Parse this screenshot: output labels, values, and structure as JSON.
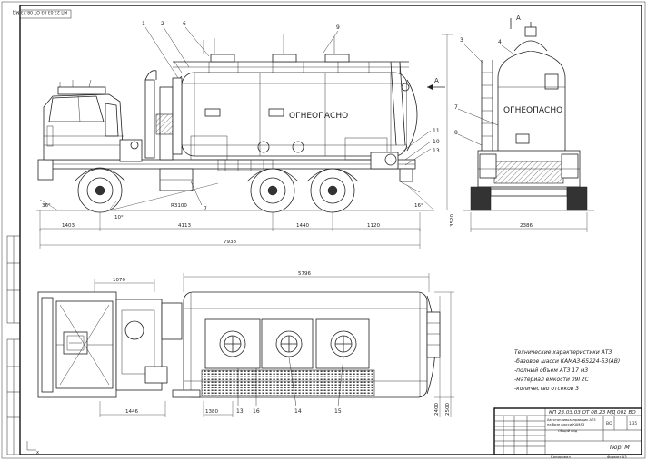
{
  "stamp_top_left": "КП 23.03.03 ОТ 08.23 МД",
  "side_view": {
    "tank_label": "ОГНЕОПАСНО",
    "position_numbers": [
      "1",
      "2",
      "6",
      "9",
      "11",
      "10",
      "13",
      "7"
    ],
    "section_mark": "А",
    "angle_left": "36°",
    "angle_middle": "10°",
    "angle_right": "16°",
    "radius": "R3100",
    "dim_front": "1403",
    "dim_base1": "4113",
    "dim_base2": "1440",
    "dim_rear": "1120",
    "dim_total_length": "7938",
    "dim_height": "3520"
  },
  "rear_view": {
    "tank_label": "ОГНЕОПАСНО",
    "position_numbers": [
      "3",
      "4",
      "7",
      "8"
    ],
    "section_mark": "А",
    "dim_width": "2386"
  },
  "top_view": {
    "position_numbers": [
      "13",
      "16",
      "14",
      "15"
    ],
    "dim_cab": "1070",
    "dim_tank": "5796",
    "dim_front_track": "1446",
    "dim_rear_track": "1380",
    "dim_width1": "2500",
    "dim_width2": "2400"
  },
  "spec_notes": {
    "title": "Технические характеристики АТЗ",
    "lines": [
      "-базовое шасси КАМАЗ-65224-53(АВ)",
      "-полный объем АТЗ 17 м3",
      "-материал ёмкости 09Г2С",
      "-количество отсеков 3"
    ]
  },
  "title_block": {
    "doc_code": "КП 23.03.03 ОТ 08.23 МД 001 ВО",
    "name_line1": "Автотопливозаправщик АТЗ",
    "name_line2": "на базе шасси КАМАЗ",
    "name_line3": "Общий вид",
    "sheet_mark": "ВО",
    "scale": "1:35",
    "org": "ТюрГМ",
    "copied_label": "Копировал",
    "format_label": "Формат А3"
  }
}
